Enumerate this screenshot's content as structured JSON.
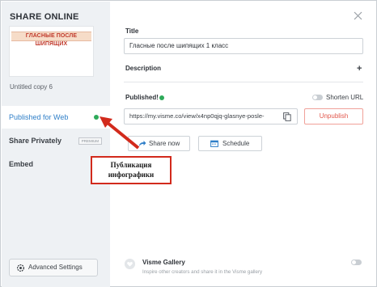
{
  "sidebar": {
    "title": "SHARE ONLINE",
    "thumbnail_text": "ГЛАСНЫЕ ПОСЛЕ ШИПЯЩИХ",
    "project_name": "Untitled copy 6",
    "items": [
      {
        "label": "Published for Web",
        "active": true,
        "status": "published"
      },
      {
        "label": "Share Privately",
        "badge": "PREMIUM"
      },
      {
        "label": "Embed"
      }
    ],
    "advanced_label": "Advanced Settings"
  },
  "form": {
    "title_label": "Title",
    "title_value": "Гласные после шипящих 1 класс",
    "description_label": "Description",
    "published_label": "Published!",
    "shorten_url_label": "Shorten URL",
    "url_value": "https://my.visme.co/view/x4np0qjq-glasnye-posle-",
    "unpublish_label": "Unpublish",
    "share_now_label": "Share now",
    "schedule_label": "Schedule"
  },
  "gallery": {
    "title": "Visme Gallery",
    "subtitle": "Inspire other creators and share it in the Visme gallery"
  },
  "annotation": {
    "line1": "Публикация",
    "line2": "инфографики"
  },
  "colors": {
    "accent": "#2f7fc8",
    "published_green": "#2eaa5a",
    "unpublish_red": "#e2574c",
    "annotation_red": "#d22a1c",
    "sidebar_bg": "#eef1f4"
  },
  "icons": {
    "close": "close-icon",
    "plus": "plus-icon",
    "copy": "copy-icon",
    "share": "share-arrow-icon",
    "schedule": "calendar-icon",
    "settings": "gear-icon",
    "gallery": "heart-icon"
  }
}
